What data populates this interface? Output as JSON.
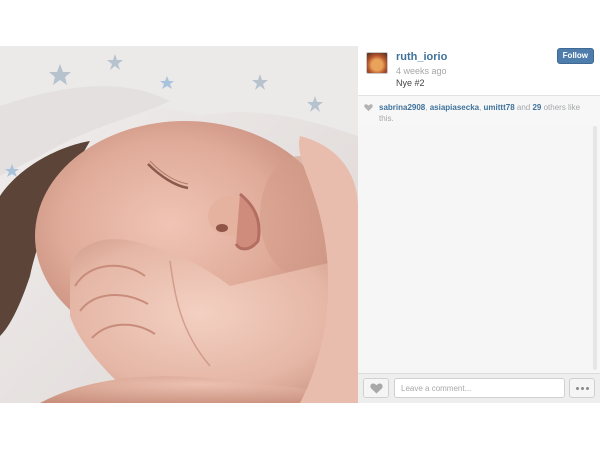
{
  "post": {
    "image_description": "",
    "user": {
      "username": "ruth_iorio",
      "avatar_icon": "user-avatar"
    },
    "timestamp": "4 weeks ago",
    "caption": "Nye #2",
    "follow_label": "Follow",
    "likes": {
      "heart_icon": "heart-icon",
      "users": [
        "sabrina2908",
        "asiapiasecka",
        "umittt78"
      ],
      "separator": ", ",
      "conjunction": " and ",
      "others_count": "29",
      "others_suffix": " others like this."
    },
    "comment": {
      "placeholder": "Leave a comment...",
      "like_icon": "heart-icon",
      "more_icon": "more-dots-icon"
    }
  },
  "colors": {
    "link": "#3f729b",
    "follow_button": "#4e7dab",
    "muted": "#a5a7aa"
  }
}
